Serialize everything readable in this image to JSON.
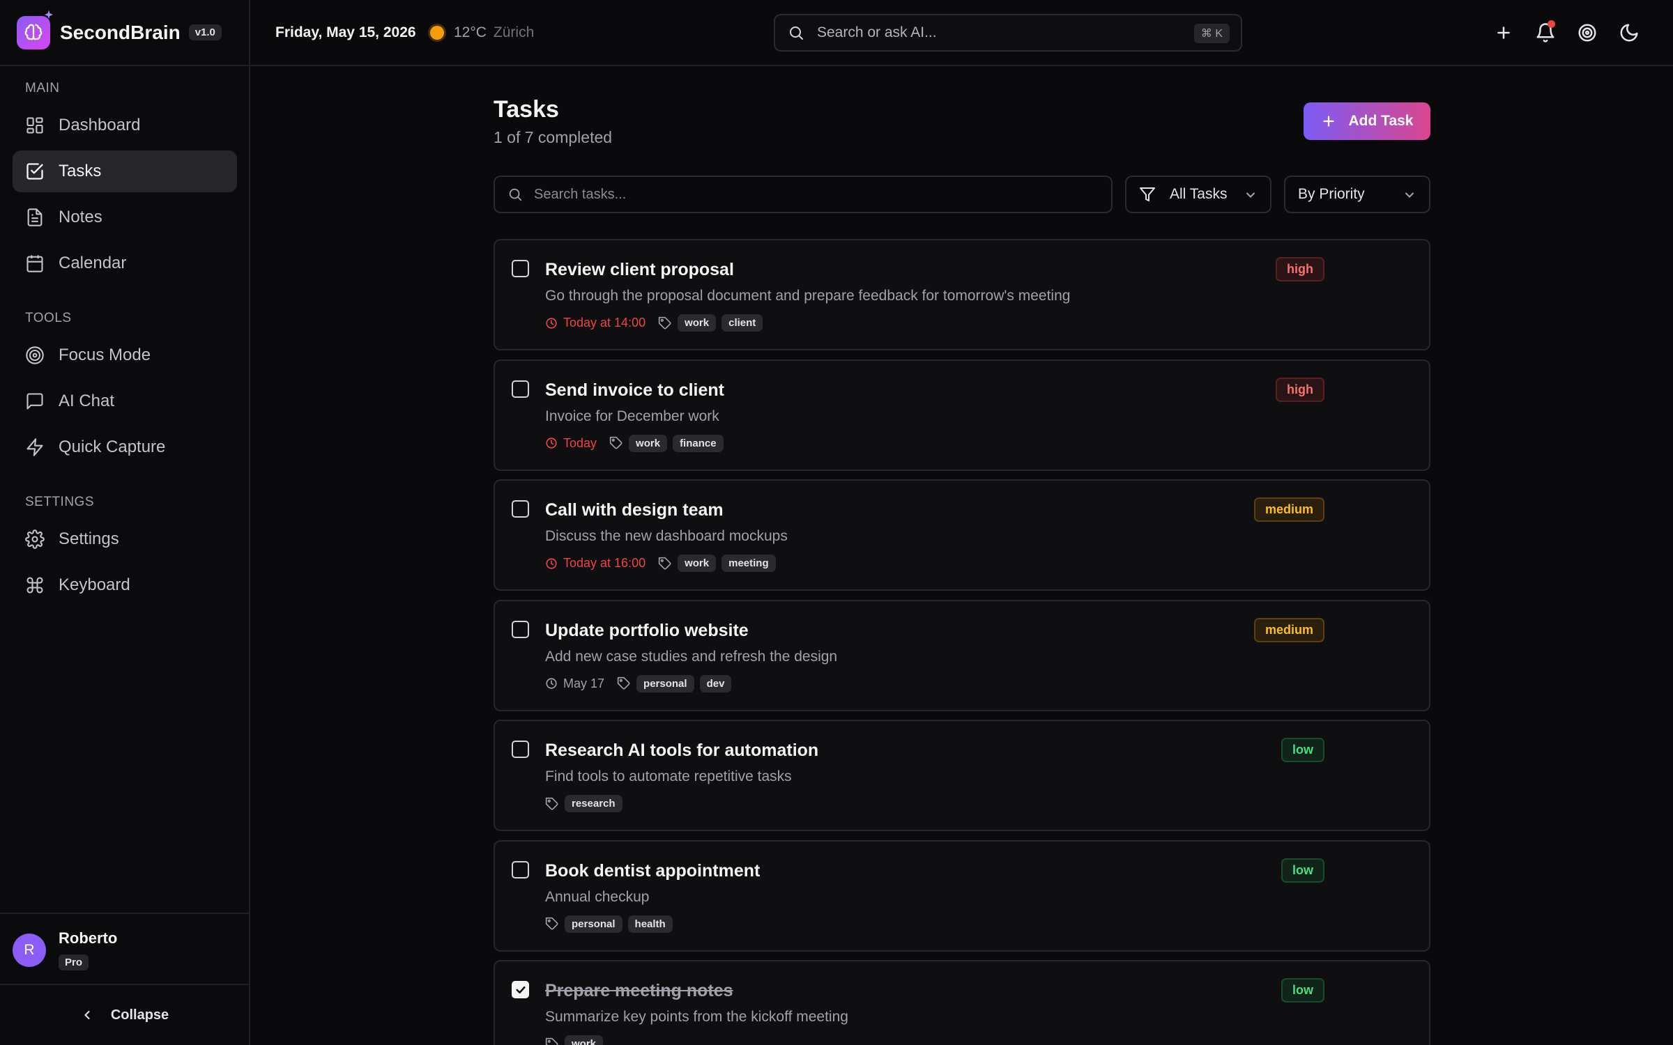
{
  "app": {
    "name": "SecondBrain",
    "version": "v1.0"
  },
  "sidebar": {
    "sections": [
      {
        "label": "MAIN",
        "items": [
          {
            "label": "Dashboard",
            "icon": "grid-icon"
          },
          {
            "label": "Tasks",
            "icon": "check-square-icon",
            "active": true
          },
          {
            "label": "Notes",
            "icon": "document-icon"
          },
          {
            "label": "Calendar",
            "icon": "calendar-icon"
          }
        ]
      },
      {
        "label": "TOOLS",
        "items": [
          {
            "label": "Focus Mode",
            "icon": "target-icon"
          },
          {
            "label": "AI Chat",
            "icon": "chat-icon"
          },
          {
            "label": "Quick Capture",
            "icon": "bolt-icon"
          }
        ]
      },
      {
        "label": "SETTINGS",
        "items": [
          {
            "label": "Settings",
            "icon": "gear-icon"
          },
          {
            "label": "Keyboard",
            "icon": "command-icon"
          }
        ]
      }
    ],
    "user": {
      "initial": "R",
      "name": "Roberto",
      "plan": "Pro"
    },
    "collapse_label": "Collapse"
  },
  "header": {
    "date": "Friday, May 15, 2026",
    "weather": {
      "temp": "12°C",
      "city": "Zürich"
    },
    "search_placeholder": "Search or ask AI...",
    "search_shortcut": "⌘ K"
  },
  "main": {
    "title": "Tasks",
    "subtitle": "1 of 7 completed",
    "add_label": "Add Task",
    "search_placeholder": "Search tasks...",
    "filter_value": "All Tasks",
    "sort_value": "By Priority",
    "tasks": [
      {
        "title": "Review client proposal",
        "description": "Go through the proposal document and prepare feedback for tomorrow's meeting",
        "due": "Today at 14:00",
        "due_style": "red",
        "tags": [
          "work",
          "client"
        ],
        "priority": "high",
        "done": false
      },
      {
        "title": "Send invoice to client",
        "description": "Invoice for December work",
        "due": "Today",
        "due_style": "red",
        "tags": [
          "work",
          "finance"
        ],
        "priority": "high",
        "done": false
      },
      {
        "title": "Call with design team",
        "description": "Discuss the new dashboard mockups",
        "due": "Today at 16:00",
        "due_style": "red",
        "tags": [
          "work",
          "meeting"
        ],
        "priority": "medium",
        "done": false
      },
      {
        "title": "Update portfolio website",
        "description": "Add new case studies and refresh the design",
        "due": "May 17",
        "due_style": "grey",
        "tags": [
          "personal",
          "dev"
        ],
        "priority": "medium",
        "done": false
      },
      {
        "title": "Research AI tools for automation",
        "description": "Find tools to automate repetitive tasks",
        "due": "",
        "due_style": "none",
        "tags": [
          "research"
        ],
        "priority": "low",
        "done": false
      },
      {
        "title": "Book dentist appointment",
        "description": "Annual checkup",
        "due": "",
        "due_style": "none",
        "tags": [
          "personal",
          "health"
        ],
        "priority": "low",
        "done": false
      },
      {
        "title": "Prepare meeting notes",
        "description": "Summarize key points from the kickoff meeting",
        "due": "",
        "due_style": "none",
        "tags": [
          "work"
        ],
        "priority": "low",
        "done": true
      }
    ]
  },
  "colors": {
    "accent_start": "#7c5cf5",
    "accent_end": "#d9468f",
    "high": "#f87171",
    "medium": "#fbbf24",
    "low": "#4ade80",
    "overdue": "#ef4444"
  }
}
